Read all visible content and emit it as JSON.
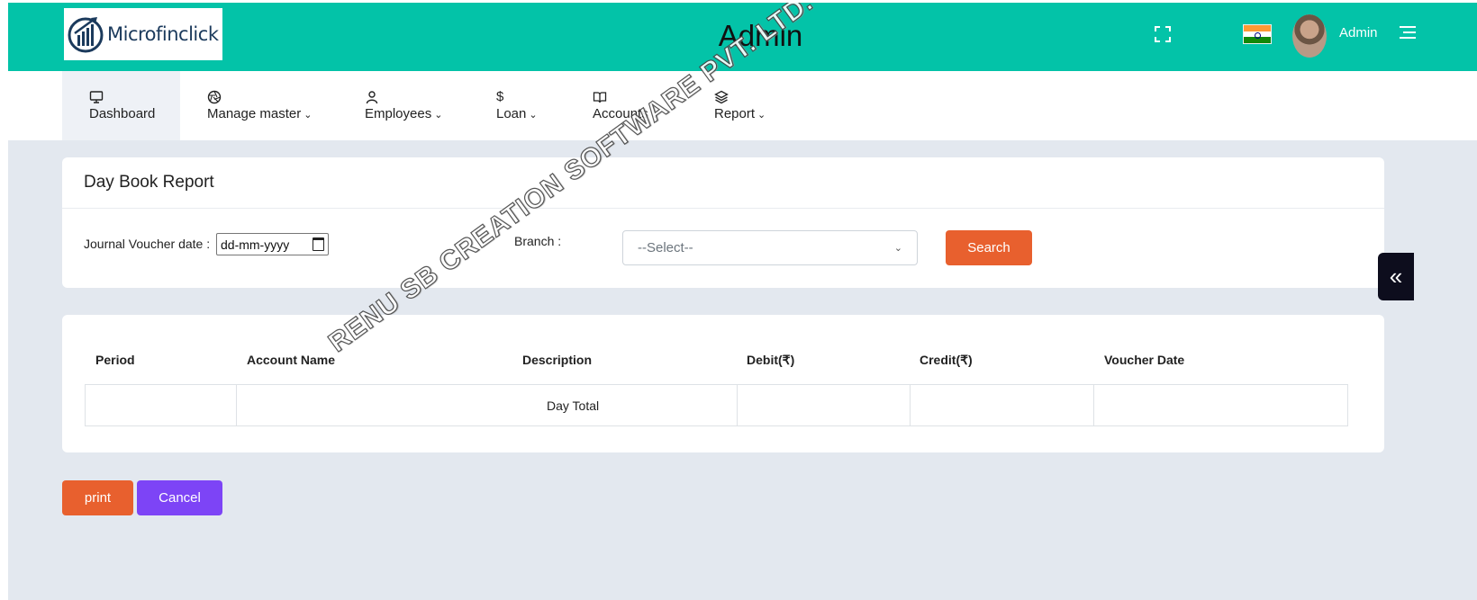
{
  "header": {
    "logo_text": "Microfinclick",
    "title": "Admin",
    "user_name": "Admin",
    "flag": "india-flag",
    "colors": {
      "header_bg": "#03c3a8",
      "accent_orange": "#e8602e",
      "accent_purple": "#7d44f6"
    }
  },
  "nav": {
    "items": [
      {
        "label": "Dashboard",
        "icon": "monitor-icon"
      },
      {
        "label": "Manage master",
        "icon": "aperture-icon"
      },
      {
        "label": "Employees",
        "icon": "user-icon"
      },
      {
        "label": "Loan",
        "icon": "dollar-icon"
      },
      {
        "label": "Accounts",
        "icon": "book-icon"
      },
      {
        "label": "Report",
        "icon": "layers-icon"
      }
    ]
  },
  "filter": {
    "title": "Day Book Report",
    "date_label": "Journal Voucher date :",
    "date_value": "dd-mm-yyyy",
    "branch_label": "Branch :",
    "branch_value": "--Select--",
    "search_label": "Search"
  },
  "table": {
    "headers": [
      "Period",
      "Account Name",
      "Description",
      "Debit(₹)",
      "Credit(₹)",
      "Voucher Date"
    ],
    "day_total": "Day Total"
  },
  "actions": {
    "print": "print",
    "cancel": "Cancel"
  },
  "side_toggle": "«",
  "watermark": "RENU SB CREATION SOFTWARE PVT. LTD."
}
